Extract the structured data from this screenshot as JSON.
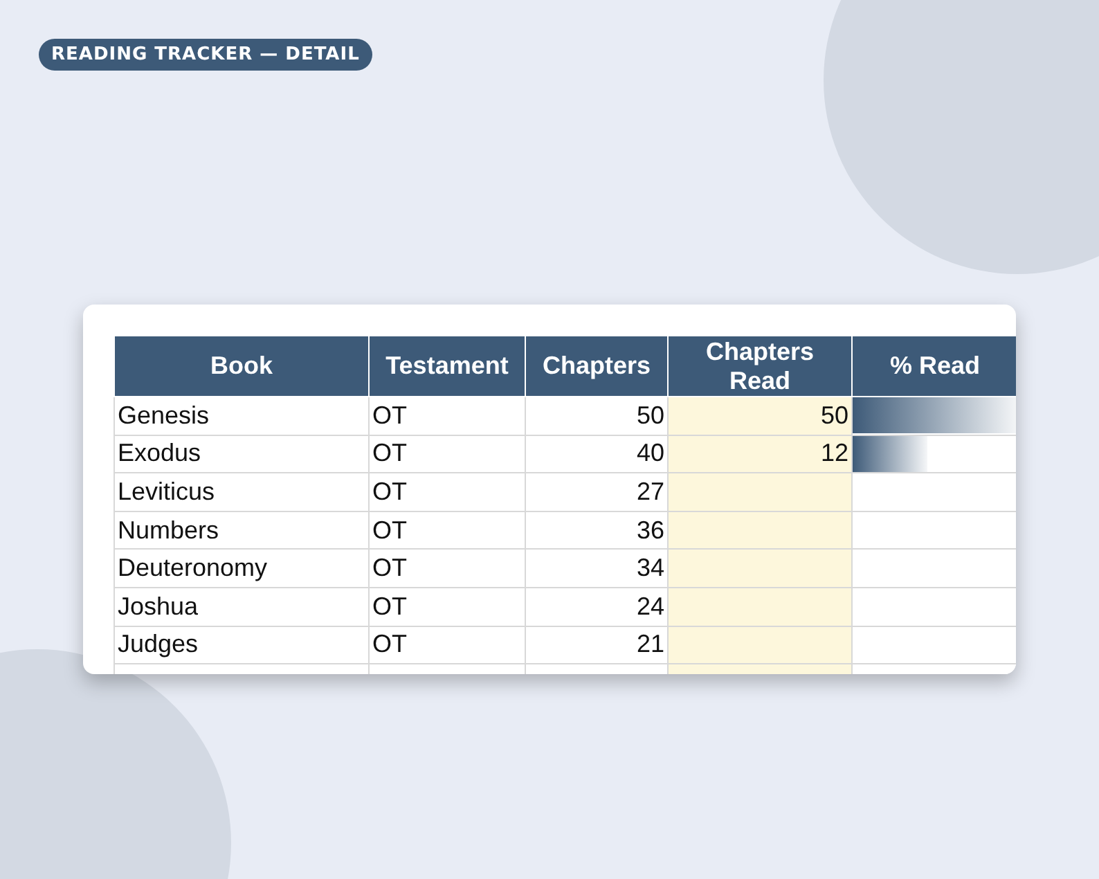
{
  "badge": "READING TRACKER — DETAIL",
  "table": {
    "columns": [
      "Book",
      "Testament",
      "Chapters",
      "Chapters Read",
      "% Read"
    ],
    "rows": [
      {
        "book": "Genesis",
        "testament": "OT",
        "chapters": "50",
        "read": "50",
        "level": 1
      },
      {
        "book": "Exodus",
        "testament": "OT",
        "chapters": "40",
        "read": "12",
        "level": 0.45
      },
      {
        "book": "Leviticus",
        "testament": "OT",
        "chapters": "27"
      },
      {
        "book": "Numbers",
        "testament": "OT",
        "chapters": "36"
      },
      {
        "book": "Deuteronomy",
        "testament": "OT",
        "chapters": "34"
      },
      {
        "book": "Joshua",
        "testament": "OT",
        "chapters": "24"
      },
      {
        "book": "Judges",
        "testament": "OT",
        "chapters": "21"
      }
    ]
  }
}
